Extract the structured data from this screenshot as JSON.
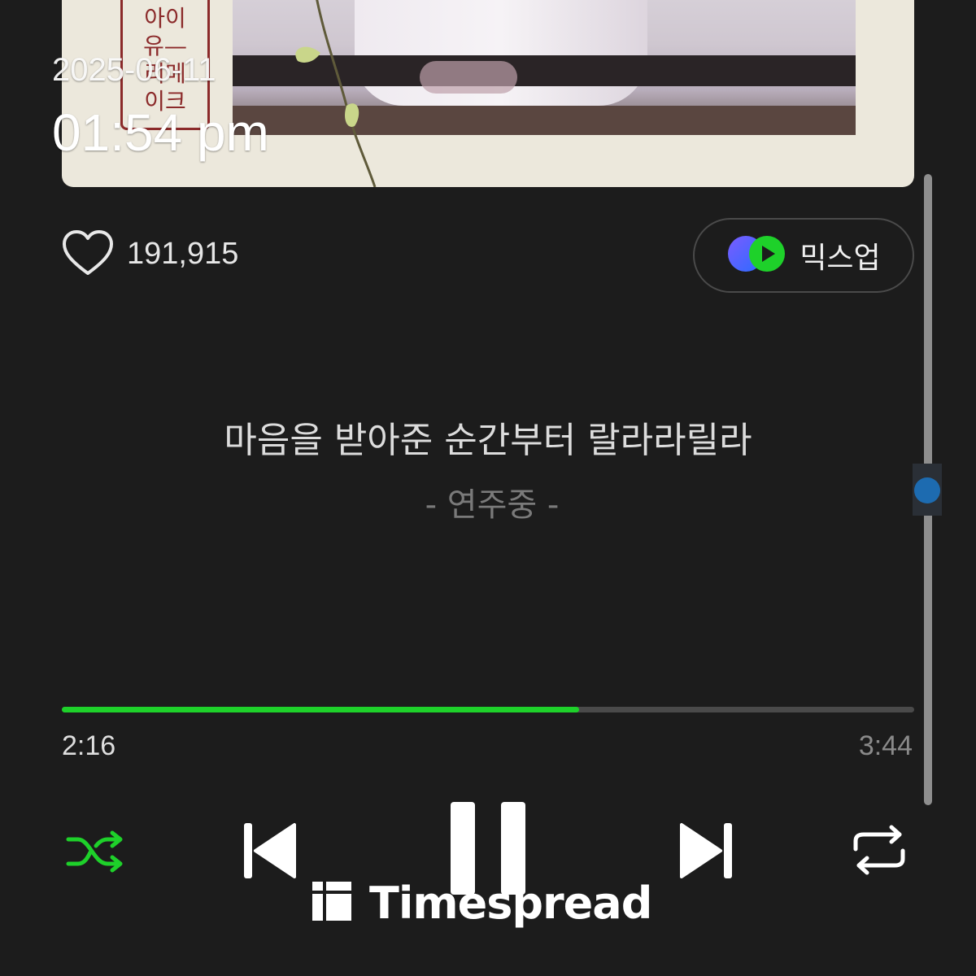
{
  "overlay": {
    "date": "2025-06-11",
    "time": "01:54 pm"
  },
  "album": {
    "stamp_lines": [
      "아이",
      "유—",
      "리메",
      "이크"
    ]
  },
  "like": {
    "count": "191,915",
    "icon": "heart-outline-icon"
  },
  "mixup": {
    "label": "믹스업",
    "icon": "mixup-icon"
  },
  "lyrics": {
    "current_line": "마음을 받아준 순간부터 랄라라릴라",
    "sub_line": "- 연주중 -"
  },
  "playback": {
    "elapsed": "2:16",
    "total": "3:44",
    "progress_fraction": 0.607,
    "shuffle_active": true,
    "is_playing": true
  },
  "controls": {
    "shuffle_icon": "shuffle-icon",
    "previous_icon": "previous-track-icon",
    "pause_icon": "pause-icon",
    "next_icon": "next-track-icon",
    "repeat_icon": "repeat-icon"
  },
  "colors": {
    "accent_green": "#1ed12a",
    "background": "#1c1c1c",
    "scroll_thumb": "#1d6bb0"
  },
  "watermark": {
    "text": "Timespread"
  }
}
